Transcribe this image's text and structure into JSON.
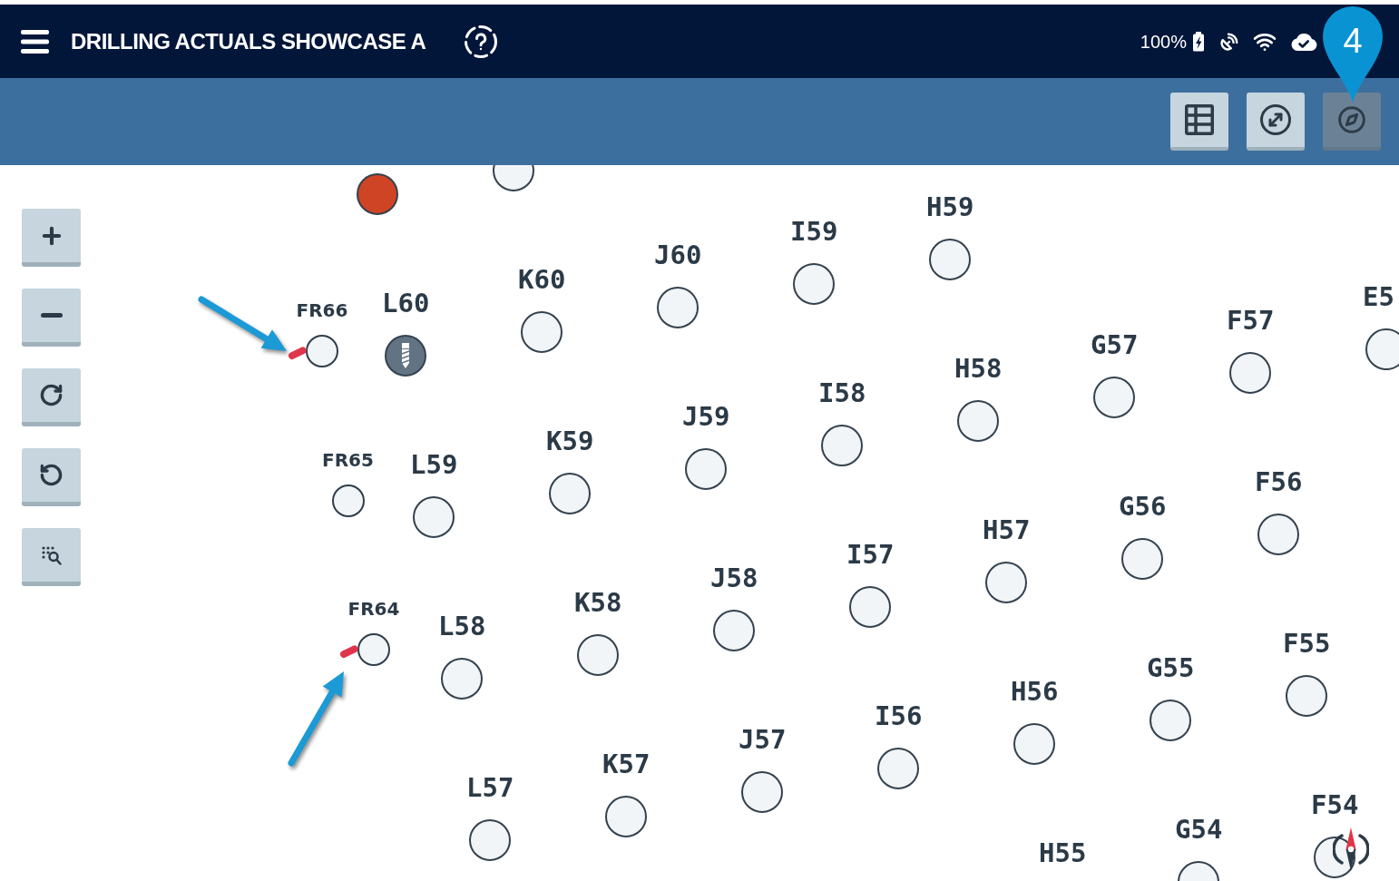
{
  "header": {
    "title": "DRILLING ACTUALS SHOWCASE A",
    "battery": "100%"
  },
  "callout": {
    "text": "4"
  },
  "view_buttons": [
    {
      "kind": "grid",
      "selected": false
    },
    {
      "kind": "measure",
      "selected": false
    },
    {
      "kind": "compass",
      "selected": true
    }
  ],
  "hole_rows": [
    {
      "holes": [
        {
          "kind": "drilled",
          "current": false
        },
        {
          "kind": "planned",
          "current": false
        }
      ]
    },
    {
      "holes": [
        {
          "label": "L60",
          "kind": "drilling",
          "current": false
        },
        {
          "label": "K60",
          "kind": "planned",
          "current": false
        },
        {
          "label": "J60",
          "kind": "planned",
          "current": false
        },
        {
          "label": "I59",
          "kind": "planned",
          "current": false
        },
        {
          "label": "H59",
          "kind": "planned",
          "current": false
        }
      ]
    },
    {
      "holes": [
        {
          "label": "L59",
          "kind": "planned",
          "current": false
        },
        {
          "label": "K59",
          "kind": "planned",
          "current": false
        },
        {
          "label": "J59",
          "kind": "planned",
          "current": false
        },
        {
          "label": "I58",
          "kind": "planned",
          "current": false
        },
        {
          "label": "H58",
          "kind": "planned",
          "current": false
        },
        {
          "label": "G57",
          "kind": "planned",
          "current": false
        },
        {
          "label": "F57",
          "kind": "planned",
          "current": false
        },
        {
          "label": "E5",
          "kind": "planned",
          "current": false
        }
      ]
    },
    {
      "holes": [
        {
          "label": "L58",
          "kind": "planned",
          "current": false
        },
        {
          "label": "K58",
          "kind": "planned",
          "current": false
        },
        {
          "label": "J58",
          "kind": "planned",
          "current": false
        },
        {
          "label": "I57",
          "kind": "planned",
          "current": false
        },
        {
          "label": "H57",
          "kind": "planned",
          "current": false
        },
        {
          "label": "G56",
          "kind": "planned",
          "current": false
        },
        {
          "label": "F56",
          "kind": "planned",
          "current": false
        }
      ]
    },
    {
      "holes": [
        {
          "label": "L57",
          "kind": "planned",
          "current": false
        },
        {
          "label": "K57",
          "kind": "planned",
          "current": false
        },
        {
          "label": "J57",
          "kind": "planned",
          "current": false
        },
        {
          "label": "I56",
          "kind": "planned",
          "current": false
        },
        {
          "label": "H56",
          "kind": "planned",
          "current": false
        },
        {
          "label": "G55",
          "kind": "planned",
          "current": false
        },
        {
          "label": "F55",
          "kind": "planned",
          "current": false
        }
      ]
    },
    {
      "holes": [
        {
          "label": "H55"
        },
        {
          "label": "G54",
          "kind": "planned",
          "current": false
        },
        {
          "label": "F54",
          "kind": "planned",
          "current": true
        }
      ]
    }
  ],
  "fr_holes": [
    {
      "label": "FR66",
      "deviation": true
    },
    {
      "label": "FR65",
      "deviation": false
    },
    {
      "label": "FR64",
      "deviation": true
    }
  ]
}
